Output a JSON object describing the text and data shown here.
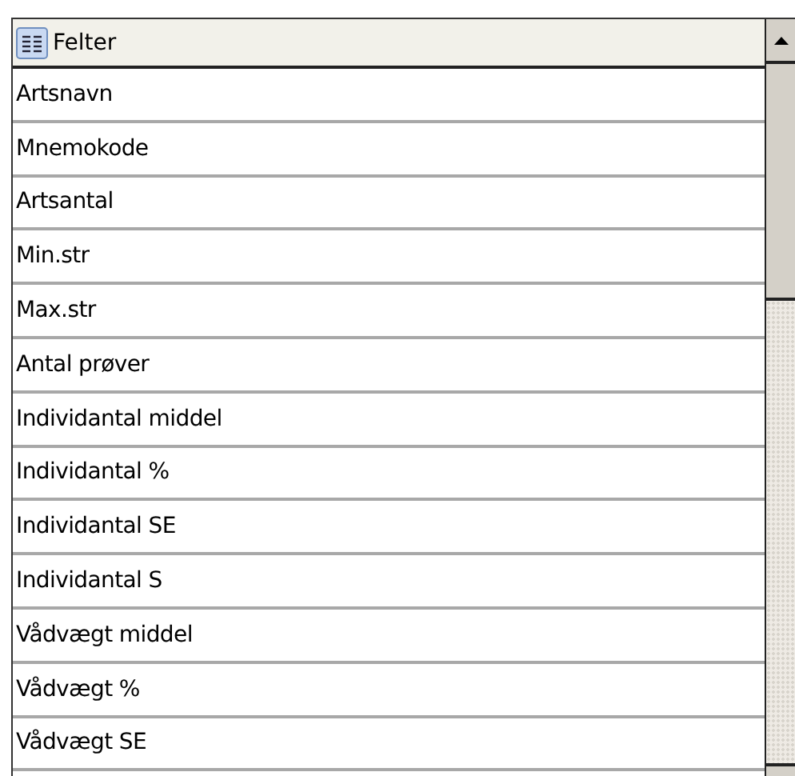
{
  "list": {
    "header": "Felter",
    "rows": [
      "Artsnavn",
      "Mnemokode",
      "Artsantal",
      "Min.str",
      "Max.str",
      "Antal prøver",
      "Individantal middel",
      "Individantal %",
      "Individantal SE",
      "Individantal S",
      "Vådvægt middel",
      "Vådvægt %",
      "Vådvægt SE"
    ]
  }
}
